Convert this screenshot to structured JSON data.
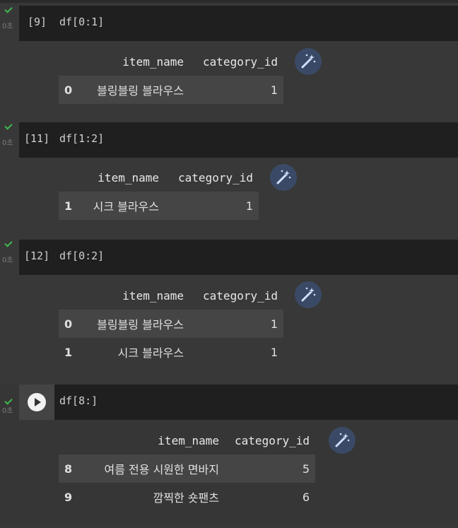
{
  "cells": [
    {
      "prompt": "[9]",
      "source": "df[0:1]",
      "time": "0초",
      "status": "done",
      "columns": [
        "item_name",
        "category_id"
      ],
      "rows": [
        {
          "index": "0",
          "item_name": "블링블링 블라우스",
          "category_id": "1"
        }
      ]
    },
    {
      "prompt": "[11]",
      "source": "df[1:2]",
      "time": "0초",
      "status": "done",
      "columns": [
        "item_name",
        "category_id"
      ],
      "rows": [
        {
          "index": "1",
          "item_name": "시크 블라우스",
          "category_id": "1"
        }
      ]
    },
    {
      "prompt": "[12]",
      "source": "df[0:2]",
      "time": "0초",
      "status": "done",
      "columns": [
        "item_name",
        "category_id"
      ],
      "rows": [
        {
          "index": "0",
          "item_name": "블링블링 블라우스",
          "category_id": "1"
        },
        {
          "index": "1",
          "item_name": "시크 블라우스",
          "category_id": "1"
        }
      ]
    },
    {
      "prompt": "",
      "source": "df[8:]",
      "time": "0초",
      "status": "run-button",
      "columns": [
        "item_name",
        "category_id"
      ],
      "rows": [
        {
          "index": "8",
          "item_name": "여름 전용 시원한 면바지",
          "category_id": "5"
        },
        {
          "index": "9",
          "item_name": "깜찍한 숏팬츠",
          "category_id": "6"
        }
      ]
    }
  ],
  "icons": {
    "check": "checkmark-icon",
    "wand": "magic-wand-icon",
    "run": "play-icon"
  },
  "colors": {
    "check": "#3fb950",
    "wand_bg": "#3a4a66",
    "code_bg": "#1f1f1f"
  }
}
